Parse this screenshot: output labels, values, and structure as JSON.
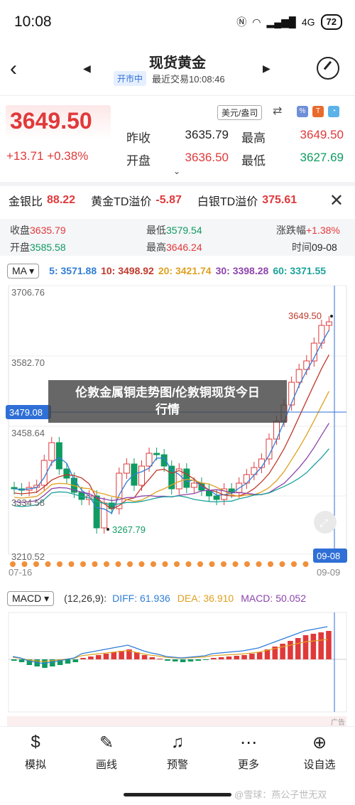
{
  "status": {
    "time": "10:08",
    "battery": "72",
    "signal": "4G"
  },
  "nav": {
    "title": "现货黄金",
    "status_badge": "开市中",
    "last_trade": "最近交易10:08:46"
  },
  "quote": {
    "price": "3649.50",
    "change": "+13.71 +0.38%",
    "currency": "美元/盎司",
    "prev_close_label": "昨收",
    "prev_close": "3635.79",
    "high_label": "最高",
    "high": "3649.50",
    "open_label": "开盘",
    "open": "3636.50",
    "low_label": "最低",
    "low": "3627.69"
  },
  "spreads": [
    {
      "label": "金银比",
      "value": "88.22",
      "color": "#e0393a"
    },
    {
      "label": "黄金TD溢价",
      "value": "-5.87",
      "color": "#e0393a"
    },
    {
      "label": "白银TD溢价",
      "value": "375.61",
      "color": "#e0393a"
    }
  ],
  "info": {
    "close_label": "收盘",
    "close": "3635.79",
    "low_label": "最低",
    "low": "3579.54",
    "chg_label": "涨跌幅",
    "chg": "+1.38%",
    "open_label": "开盘",
    "open": "3585.58",
    "high_label": "最高",
    "high": "3646.24",
    "time_label": "时间",
    "time": "09-08"
  },
  "ma": {
    "selector": "MA",
    "items": [
      {
        "text": "5: 3571.88",
        "color": "#2f7dd6"
      },
      {
        "text": "10: 3498.92",
        "color": "#c0392b"
      },
      {
        "text": "20: 3421.74",
        "color": "#e0a020"
      },
      {
        "text": "30: 3398.28",
        "color": "#8e44ad"
      },
      {
        "text": "60: 3371.55",
        "color": "#1aa39a"
      }
    ]
  },
  "chart": {
    "y_labels": [
      "3706.76",
      "3582.70",
      "3458.64",
      "3334.58",
      "3210.52"
    ],
    "crosshair_price": "3479.08",
    "crosshair_date": "09-08",
    "x_start": "07-16",
    "x_end": "09-09",
    "max_marker": "3649.50",
    "min_marker": "3267.79",
    "up_color": "#e0393a",
    "down_color": "#0f9b61"
  },
  "banner": {
    "line1": "伦敦金属铜走势图/伦敦铜现货今日",
    "line2": "行情"
  },
  "macd": {
    "selector": "MACD",
    "params": "(12,26,9):",
    "diff": "DIFF: 61.936",
    "dea": "DEA: 36.910",
    "macd": "MACD: 50.052",
    "diff_color": "#2f7dd6",
    "dea_color": "#e0a020",
    "macd_color": "#8e44ad"
  },
  "ad_label": "广告",
  "toolbar": [
    {
      "label": "模拟",
      "icon": "simulate-icon"
    },
    {
      "label": "画线",
      "icon": "pen-icon"
    },
    {
      "label": "预警",
      "icon": "bell-icon"
    },
    {
      "label": "更多",
      "icon": "more-icon"
    },
    {
      "label": "设自选",
      "icon": "add-favorite-icon"
    }
  ],
  "watermark": "@雪球：燕公子世无双"
}
